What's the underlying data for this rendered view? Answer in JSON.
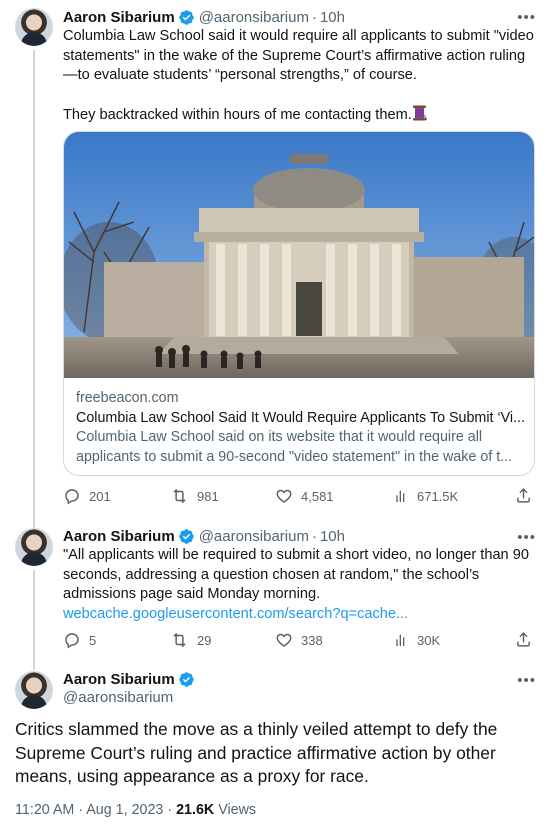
{
  "tweet1": {
    "name": "Aaron Sibarium",
    "handle": "@aaronsibarium",
    "sep": "·",
    "time": "10h",
    "more": "•••",
    "text_p1": "Columbia Law School said it would require all applicants to submit \"video statements\" in the wake of the Supreme Court’s affirmative action ruling—to evaluate students’ “personal strengths,” of course.",
    "text_p2": "They backtracked within hours of me contacting them.",
    "emoji": "thread-spool-emoji",
    "card": {
      "domain": "freebeacon.com",
      "title": "Columbia Law School Said It Would Require Applicants To Submit ‘Vi...",
      "description": "Columbia Law School said on its website that it would require all applicants to submit a 90-second \"video statement\" in the wake of t..."
    },
    "actions": {
      "replies": "201",
      "retweets": "981",
      "likes": "4,581",
      "views": "671.5K"
    }
  },
  "tweet2": {
    "name": "Aaron Sibarium",
    "handle": "@aaronsibarium",
    "sep": "·",
    "time": "10h",
    "more": "•••",
    "text": "\"All applicants will be required to submit a short video, no longer than 90 seconds, addressing a question chosen at random,\" the school’s admissions page said Monday morning.",
    "link": "webcache.googleusercontent.com/search?q=cache...",
    "actions": {
      "replies": "5",
      "retweets": "29",
      "likes": "338",
      "views": "30K"
    }
  },
  "tweet3": {
    "name": "Aaron Sibarium",
    "handle": "@aaronsibarium",
    "more": "•••",
    "text": "Critics slammed the move as a thinly veiled attempt to defy the Supreme Court’s ruling and practice affirmative action by other means, using appearance as a proxy for race.",
    "time": "11:20 AM · Aug 1, 2023 · ",
    "views_count": "21.6K",
    "views_label": " Views"
  },
  "colors": {
    "accent": "#1d9bf0",
    "secondary_text": "#536471",
    "border": "#cfd9de"
  },
  "icons": [
    "verified-badge-icon",
    "more-icon",
    "reply-icon",
    "retweet-icon",
    "like-icon",
    "views-icon",
    "share-icon"
  ]
}
